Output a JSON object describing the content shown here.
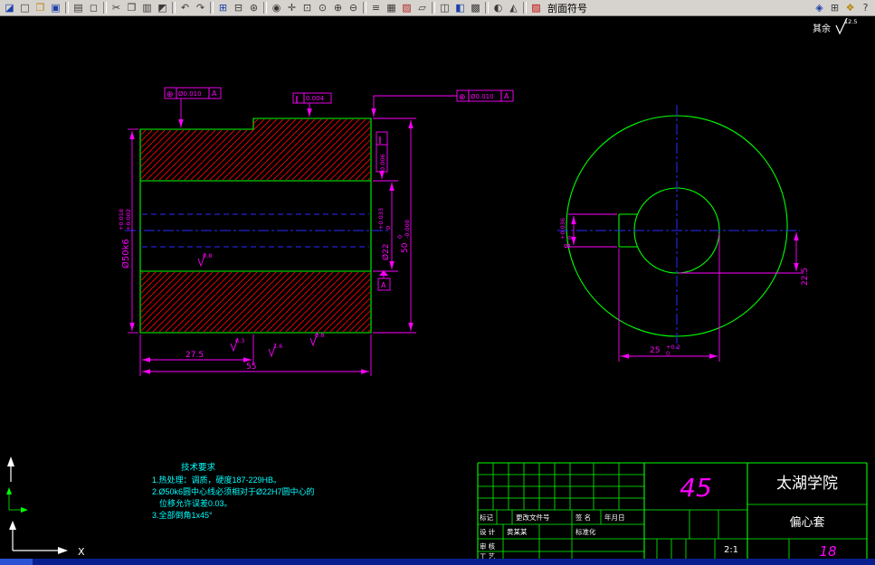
{
  "toolbar": {
    "section_symbol_label": "剖面符号",
    "buttons": [
      {
        "t": "btn",
        "n": "app-menu",
        "g": "◪",
        "c": "#1c3faa"
      },
      {
        "t": "btn",
        "n": "new-file",
        "g": "□"
      },
      {
        "t": "btn",
        "n": "open-file",
        "g": "❒",
        "c": "#b8860b"
      },
      {
        "t": "btn",
        "n": "save-file",
        "g": "▣",
        "c": "#1c3faa"
      },
      {
        "t": "sep"
      },
      {
        "t": "btn",
        "n": "print",
        "g": "▤"
      },
      {
        "t": "btn",
        "n": "print-preview",
        "g": "◻"
      },
      {
        "t": "sep"
      },
      {
        "t": "btn",
        "n": "cut",
        "g": "✂"
      },
      {
        "t": "btn",
        "n": "copy",
        "g": "❐"
      },
      {
        "t": "btn",
        "n": "paste",
        "g": "▥"
      },
      {
        "t": "btn",
        "n": "match-properties",
        "g": "◩"
      },
      {
        "t": "sep"
      },
      {
        "t": "btn",
        "n": "undo",
        "g": "↶"
      },
      {
        "t": "btn",
        "n": "redo",
        "g": "↷"
      },
      {
        "t": "sep"
      },
      {
        "t": "btn",
        "n": "insert-block",
        "g": "⊞",
        "c": "#1c3faa"
      },
      {
        "t": "btn",
        "n": "xref",
        "g": "⊟"
      },
      {
        "t": "btn",
        "n": "hyperlink",
        "g": "⊛"
      },
      {
        "t": "sep"
      },
      {
        "t": "btn",
        "n": "zoom-realtime",
        "g": "◉"
      },
      {
        "t": "btn",
        "n": "pan",
        "g": "✛"
      },
      {
        "t": "btn",
        "n": "zoom-window",
        "g": "⊡"
      },
      {
        "t": "btn",
        "n": "zoom-previous",
        "g": "⊙"
      },
      {
        "t": "btn",
        "n": "zoom-in",
        "g": "⊕"
      },
      {
        "t": "btn",
        "n": "zoom-out",
        "g": "⊖"
      },
      {
        "t": "sep"
      },
      {
        "t": "btn",
        "n": "layer-manager",
        "g": "≡"
      },
      {
        "t": "btn",
        "n": "layer-control",
        "g": "▦"
      },
      {
        "t": "btn",
        "n": "color-control",
        "g": "▨",
        "c": "#b22222"
      },
      {
        "t": "btn",
        "n": "linetype-control",
        "g": "▱"
      },
      {
        "t": "sep"
      },
      {
        "t": "btn",
        "n": "properties",
        "g": "◫"
      },
      {
        "t": "btn",
        "n": "design-center",
        "g": "◧",
        "c": "#1c3faa"
      },
      {
        "t": "btn",
        "n": "tool-palettes",
        "g": "▩"
      },
      {
        "t": "sep"
      },
      {
        "t": "btn",
        "n": "render",
        "g": "◐"
      },
      {
        "t": "btn",
        "n": "materials",
        "g": "◭"
      },
      {
        "t": "sep"
      },
      {
        "t": "btn",
        "n": "section-symbol",
        "g": "▨",
        "c": "#c00000"
      },
      {
        "t": "label"
      },
      {
        "t": "gap"
      },
      {
        "t": "btn",
        "n": "object-snap",
        "g": "◈",
        "c": "#1c3faa"
      },
      {
        "t": "btn",
        "n": "grid-display",
        "g": "⊞"
      },
      {
        "t": "btn",
        "n": "properties-panel",
        "g": "❖",
        "c": "#b8860b"
      },
      {
        "t": "btn",
        "n": "help",
        "g": "?"
      }
    ]
  },
  "drawing": {
    "colors": {
      "outline": "#00ff00",
      "hatch": "#ff0000",
      "centerline": "#2a2aff",
      "dimension": "#ff00ff",
      "notes": "#00ffff",
      "text": "#ffffff"
    },
    "rest_note": {
      "label": "其余",
      "value": "12.5"
    },
    "notes": {
      "title": "技术要求",
      "line1": "1.热处理：调质，硬度187-229HB。",
      "line2": "2.Ø50k6圆中心线必须相对于Ø22H7圆中心的",
      "line3": "位移允许误差0.03。",
      "line4": "3.全部倒角1x45°"
    },
    "dims": {
      "d50": {
        "main": "Ø50k6",
        "tu": "+0.018",
        "td": "+0.002"
      },
      "d22": {
        "main": "Ø22",
        "tu": "+0.033",
        "td": "0"
      },
      "d50b": {
        "main": "50",
        "tu": "0",
        "td": "-0.008"
      },
      "l275": "27.5",
      "l55": "55",
      "key_width": {
        "main": "8",
        "tu": "+0.036",
        "td": "0"
      },
      "key_depth": {
        "main": "25",
        "tu": "+0.2",
        "td": "0"
      },
      "ecc": "22.5",
      "fcf_pos1": {
        "sym": "⊕",
        "val": "Ø0.010",
        "datum": "A"
      },
      "fcf_par1": {
        "sym": "∥",
        "val": "0.004"
      },
      "fcf_par2": {
        "sym": "∥",
        "val": "0.006"
      },
      "fcf_pos2": {
        "sym": "⊕",
        "val": "Ø0.010",
        "datum": "A"
      },
      "datum": "A",
      "ra_bore": "0.8",
      "ra1": "6.3",
      "ra2": "1.6",
      "ra3": "0.8"
    },
    "title_block": {
      "material": "45",
      "org": "太湖学院",
      "part": "偏心套",
      "sheet_no": "18",
      "scale": "2:1",
      "labels": {
        "mark": "标记",
        "change": "更改文件号",
        "sign": "签 名",
        "date": "年月日",
        "design": "设 计",
        "designer": "黄某某",
        "standard": "标准化",
        "check": "审 核",
        "process": "工 艺"
      }
    },
    "ucs": {
      "x_label": "X"
    }
  }
}
